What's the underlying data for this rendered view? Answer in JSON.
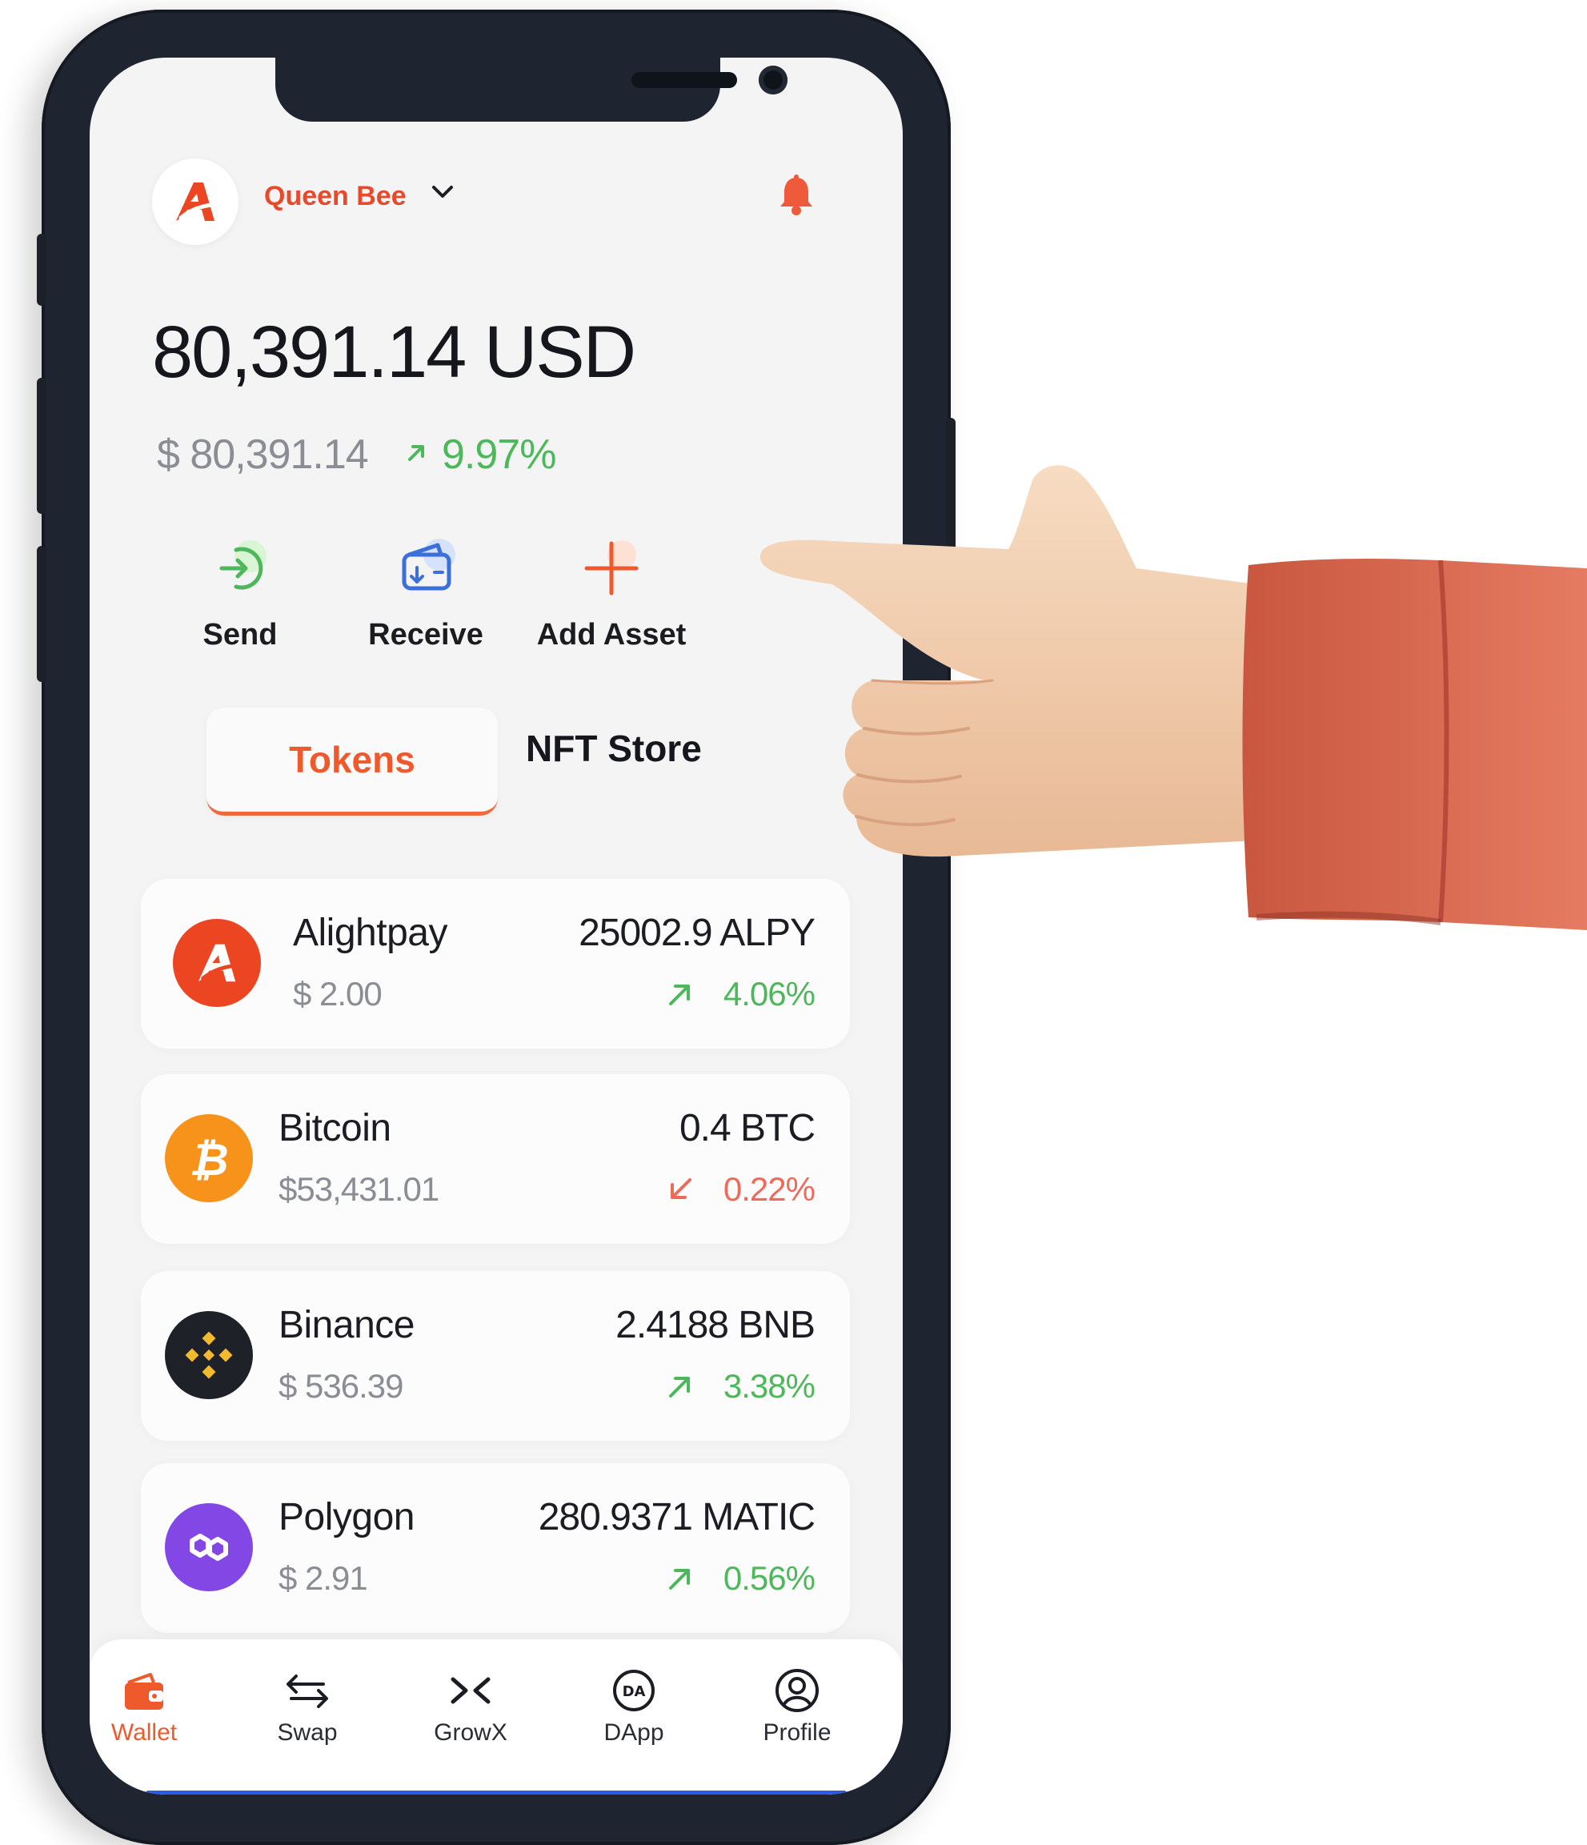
{
  "header": {
    "account_name": "Queen Bee"
  },
  "balance": {
    "main": "80,391.14 USD",
    "secondary": "$ 80,391.14",
    "change": "9.97%"
  },
  "actions": [
    {
      "label": "Send"
    },
    {
      "label": "Receive"
    },
    {
      "label": "Add Asset"
    }
  ],
  "tabs": [
    {
      "label": "Tokens",
      "active": true
    },
    {
      "label": "NFT Store",
      "active": false
    }
  ],
  "tokens": [
    {
      "name": "Alightpay",
      "price": "$ 2.00",
      "amount": "25002.9 ALPY",
      "change": "4.06%",
      "direction": "up",
      "color": "#ec4522"
    },
    {
      "name": "Bitcoin",
      "price": "$53,431.01",
      "amount": "0.4 BTC",
      "change": "0.22%",
      "direction": "down",
      "color": "#f7931a"
    },
    {
      "name": "Binance",
      "price": "$ 536.39",
      "amount": "2.4188 BNB",
      "change": "3.38%",
      "direction": "up",
      "color": "#1e2128"
    },
    {
      "name": "Polygon",
      "price": "$ 2.91",
      "amount": "280.9371 MATIC",
      "change": "0.56%",
      "direction": "up",
      "color": "#8247e5"
    }
  ],
  "nav": [
    {
      "label": "Wallet",
      "active": true
    },
    {
      "label": "Swap",
      "active": false
    },
    {
      "label": "GrowX",
      "active": false
    },
    {
      "label": "DApp",
      "active": false
    },
    {
      "label": "Profile",
      "active": false
    }
  ],
  "colors": {
    "accent": "#ee5a2c",
    "positive": "#4db85a",
    "negative": "#ee6a5a",
    "sleeve": "#dd735c",
    "skin": "#f3cfb1"
  }
}
